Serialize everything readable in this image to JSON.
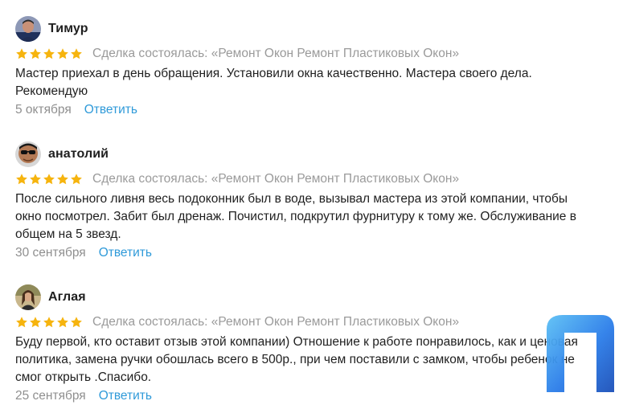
{
  "deal_prefix": "Сделка состоялась: «Ремонт Окон Ремонт Пластиковых Окон»",
  "reply_label": "Ответить",
  "star_color": "#f6b40e",
  "reviews": [
    {
      "author": "Тимур",
      "rating": 5,
      "deal": "Сделка состоялась: «Ремонт Окон Ремонт Пластиковых Окон»",
      "text": "Мастер приехал в день обращения. Установили окна качественно. Мастера своего дела. Рекомендую",
      "date": "5 октября",
      "reply": "Ответить",
      "avatar": "user-avatar-photo"
    },
    {
      "author": "анатолий",
      "rating": 5,
      "deal": "Сделка состоялась: «Ремонт Окон Ремонт Пластиковых Окон»",
      "text": "После сильного ливня весь подоконник был в воде, вызывал мастера из этой компании, чтобы окно посмотрел. Забит был дренаж. Почистил, подкрутил фурнитуру к тому же. Обслуживание в общем на 5 звезд.",
      "date": "30 сентября",
      "reply": "Ответить",
      "avatar": "user-avatar-photo"
    },
    {
      "author": "Аглая",
      "rating": 5,
      "deal": "Сделка состоялась: «Ремонт Окон Ремонт Пластиковых Окон»",
      "text": "Буду первой, кто оставит отзыв этой компании) Отношение к работе понравилось, как и ценовая политика, замена ручки обошлась всего в 500р., при чем поставили с замком, чтобы ребенок не смог открыть .Спасибо.",
      "date": "25 сентября",
      "reply": "Ответить",
      "avatar": "user-avatar-photo"
    }
  ],
  "watermark": {
    "icon": "brand-logo-icon",
    "colors": [
      "#2b7de9",
      "#1b4fb8",
      "#5dc1f5"
    ]
  }
}
